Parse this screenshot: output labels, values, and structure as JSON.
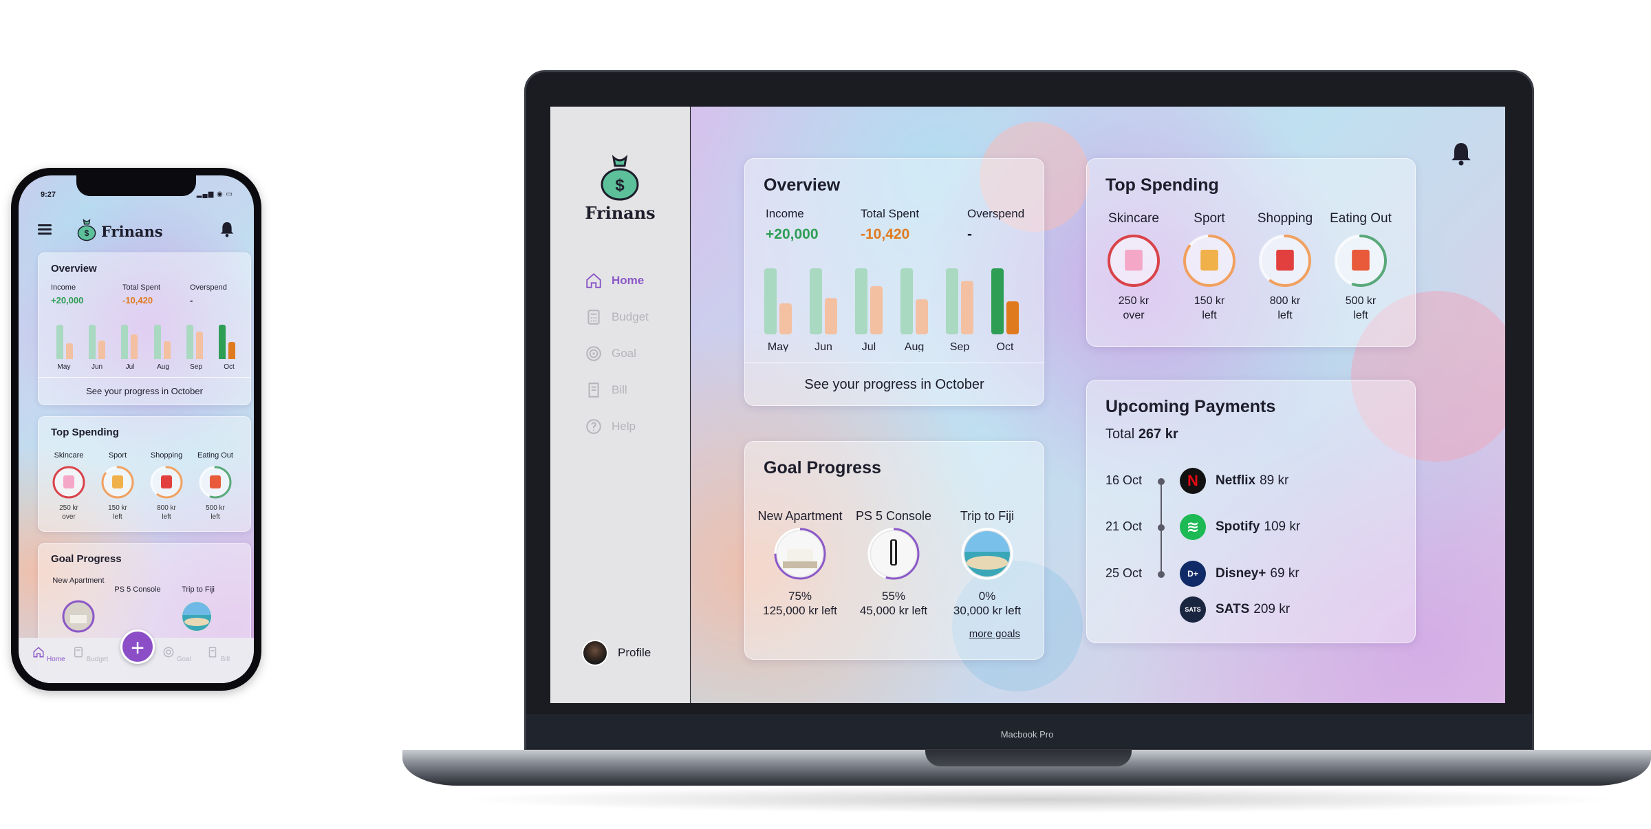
{
  "colors": {
    "accent": "#8b58c7",
    "income": "#2f9e55",
    "spent": "#e07a1f",
    "bar_light_green": "#a9d9c0",
    "bar_light_orange": "#f3c0a2",
    "bar_green": "#2f9e55",
    "bar_orange": "#e07a1f"
  },
  "app": {
    "brand": "Frinans"
  },
  "phone": {
    "time": "9:27",
    "status_icons": "▂▄▆ ◉ ▭",
    "tabs": [
      {
        "label": "Home",
        "icon": "home-icon",
        "active": true
      },
      {
        "label": "Budget",
        "icon": "budget-icon",
        "active": false
      },
      {
        "label": "Goal",
        "icon": "goal-icon",
        "active": false
      },
      {
        "label": "Bill",
        "icon": "bill-icon",
        "active": false
      }
    ],
    "fab_label": "+",
    "goals": [
      {
        "name": "New Apartment"
      },
      {
        "name": "PS 5 Console"
      },
      {
        "name": "Trip to Fiji"
      }
    ]
  },
  "sidebar": {
    "items": [
      {
        "label": "Home",
        "icon": "home-icon",
        "active": true
      },
      {
        "label": "Budget",
        "icon": "budget-icon",
        "active": false
      },
      {
        "label": "Goal",
        "icon": "goal-icon",
        "active": false
      },
      {
        "label": "Bill",
        "icon": "bill-icon",
        "active": false
      },
      {
        "label": "Help",
        "icon": "help-icon",
        "active": false
      }
    ],
    "profile_label": "Profile"
  },
  "overview": {
    "title": "Overview",
    "income_label": "Income",
    "income_value": "+20,000",
    "spent_label": "Total Spent",
    "spent_value": "-10,420",
    "overspend_label": "Overspend",
    "overspend_value": "-",
    "link": "See your progress in October",
    "months": [
      "May",
      "Jun",
      "Jul",
      "Aug",
      "Sep",
      "Oct"
    ],
    "income_bars": [
      1.0,
      1.0,
      1.0,
      1.0,
      1.0,
      1.0
    ],
    "spent_bars": [
      0.47,
      0.55,
      0.73,
      0.53,
      0.81,
      0.5
    ],
    "highlight_month": "Oct"
  },
  "top_spending": {
    "title": "Top Spending",
    "items": [
      {
        "category": "Skincare",
        "note": "250 kr over",
        "line1": "250 kr",
        "line2": "over",
        "ring_color": "#d9434a",
        "progress": 1.0,
        "icon": "skincare-icon"
      },
      {
        "category": "Sport",
        "note": "150 kr left",
        "line1": "150 kr",
        "line2": "left",
        "ring_color": "#f0a060",
        "progress": 0.85,
        "icon": "tennis-racket-icon"
      },
      {
        "category": "Shopping",
        "note": "800 kr left",
        "line1": "800 kr",
        "line2": "left",
        "ring_color": "#f0a060",
        "progress": 0.6,
        "icon": "shopping-bag-icon"
      },
      {
        "category": "Eating Out",
        "note": "500 kr left",
        "line1": "500 kr",
        "line2": "left",
        "ring_color": "#59a87a",
        "progress": 0.55,
        "icon": "burger-icon"
      }
    ]
  },
  "goal_progress": {
    "title": "Goal Progress",
    "items": [
      {
        "name": "New Apartment",
        "percent": "75%",
        "progress": 0.75,
        "left": "125,000 kr left",
        "icon": "apartment-icon"
      },
      {
        "name": "PS 5 Console",
        "percent": "55%",
        "progress": 0.55,
        "left": "45,000 kr left",
        "icon": "console-icon"
      },
      {
        "name": "Trip to Fiji",
        "percent": "0%",
        "progress": 0,
        "left": "30,000 kr left",
        "icon": "beach-icon"
      }
    ],
    "more_link": "more goals"
  },
  "upcoming": {
    "title": "Upcoming Payments",
    "total_label": "Total",
    "total_value": "267 kr",
    "dates": [
      "16 Oct",
      "21 Oct",
      "25 Oct"
    ],
    "payments": [
      {
        "name": "Netflix",
        "amount": "89 kr",
        "logo_text": "N",
        "color": "#111111",
        "text_color": "#e50914"
      },
      {
        "name": "Spotify",
        "amount": "109 kr",
        "logo_text": "≋",
        "color": "#1db954",
        "text_color": "#ffffff"
      },
      {
        "name": "Disney+",
        "amount": "69 kr",
        "logo_text": "D+",
        "color": "#0f2a66",
        "text_color": "#ffffff"
      },
      {
        "name": "SATS",
        "amount": "209 kr",
        "logo_text": "SATS",
        "color": "#1a2540",
        "text_color": "#ffffff"
      }
    ]
  },
  "laptop_label": "Macbook Pro"
}
